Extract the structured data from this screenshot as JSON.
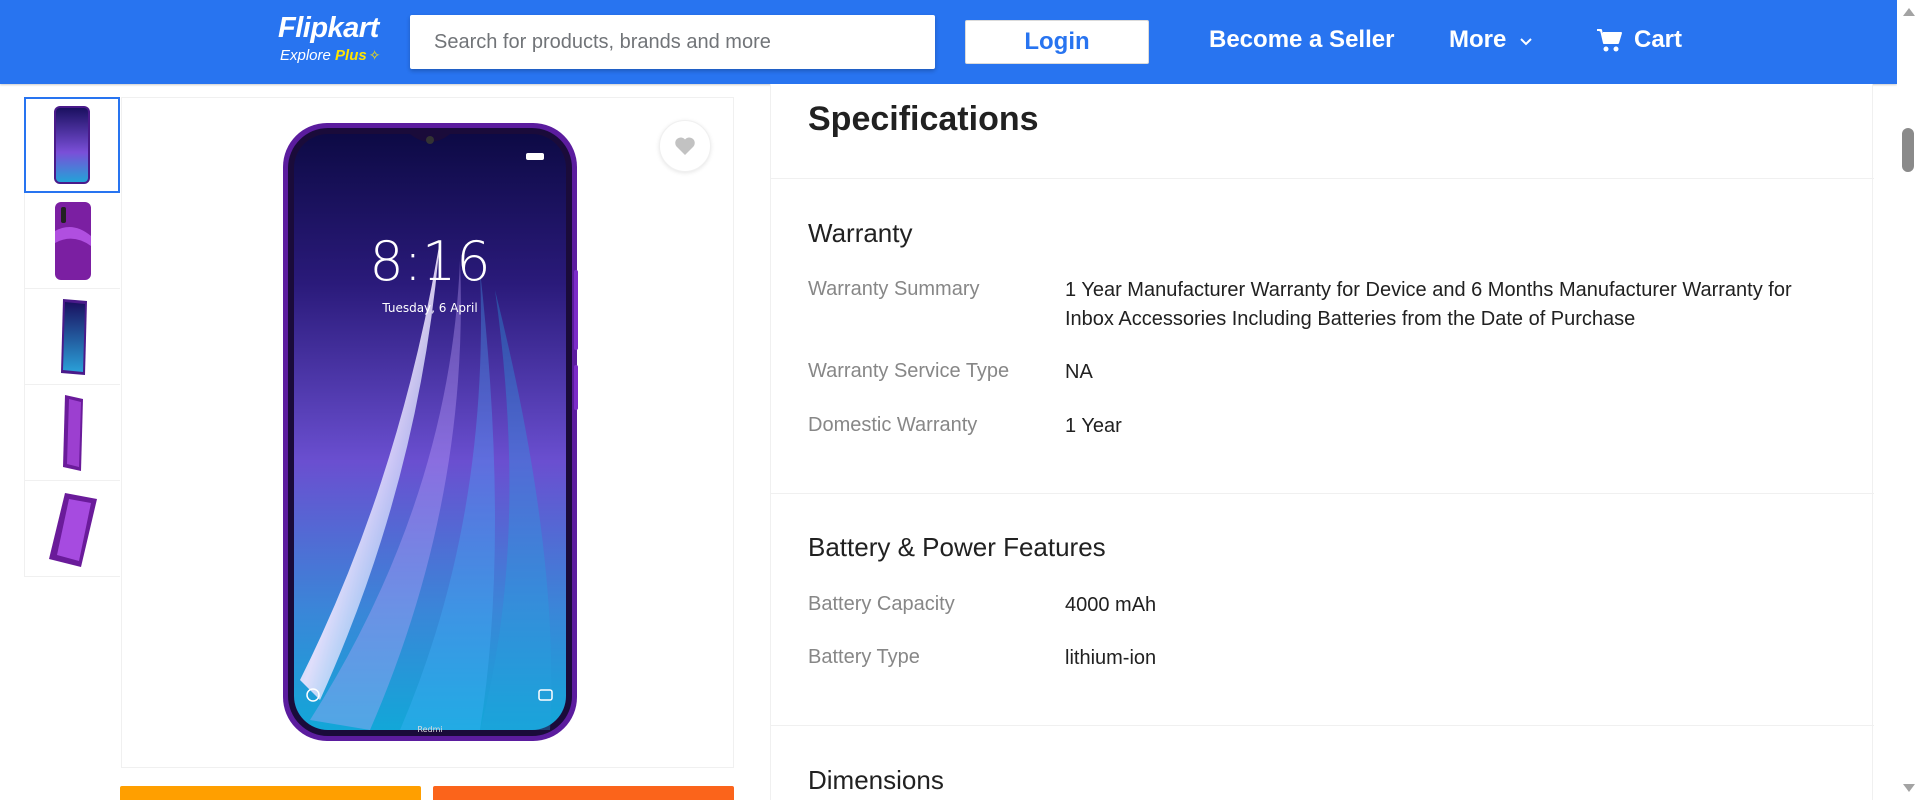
{
  "header": {
    "logo_name": "Flipkart",
    "logo_sub_prefix": "Explore ",
    "logo_sub_plus": "Plus",
    "search_placeholder": "Search for products, brands and more",
    "login_label": "Login",
    "become_seller_label": "Become a Seller",
    "more_label": "More",
    "cart_label": "Cart",
    "brand_color": "#2874f0",
    "logo_accent_color": "#ffe500"
  },
  "gallery": {
    "thumbnail_count": 5,
    "active_thumbnail": 1,
    "phone": {
      "time": "8:16",
      "date": "Tuesday, 6 April",
      "brand_mark": "Redmi"
    }
  },
  "buttons": {
    "add_to_cart_color": "#ff9f00",
    "buy_now_color": "#fb641b"
  },
  "specifications": {
    "title": "Specifications",
    "sections": [
      {
        "title": "Warranty",
        "rows": [
          {
            "label": "Warranty Summary",
            "value": "1 Year Manufacturer Warranty for Device and 6 Months Manufacturer Warranty for Inbox Accessories Including Batteries from the Date of Purchase"
          },
          {
            "label": "Warranty Service Type",
            "value": "NA"
          },
          {
            "label": "Domestic Warranty",
            "value": "1 Year"
          }
        ]
      },
      {
        "title": "Battery & Power Features",
        "rows": [
          {
            "label": "Battery Capacity",
            "value": "4000 mAh"
          },
          {
            "label": "Battery Type",
            "value": "lithium-ion"
          }
        ]
      },
      {
        "title": "Dimensions",
        "rows": []
      }
    ]
  }
}
